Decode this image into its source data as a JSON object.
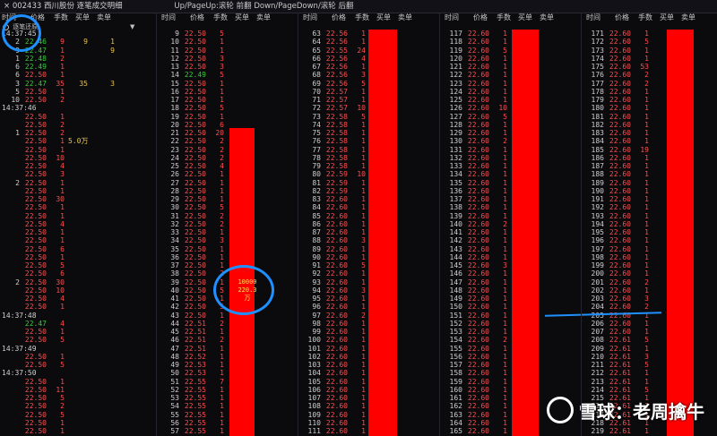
{
  "titlebar": {
    "title": "× 002433 西川股份 逐笔成交明细",
    "hint": "Up/PageUp:滚轮 前翻 Down/PageDown/滚轮 后翻"
  },
  "headers": [
    "时间",
    "价格",
    "手数",
    "买单",
    "卖单",
    "时间",
    "价格",
    "手数",
    "买单",
    "卖单",
    "时间",
    "价格",
    "手数",
    "买单",
    "卖单",
    "时间",
    "价格",
    "手数",
    "买单",
    "卖单",
    "时间",
    "价格",
    "手数",
    "买单",
    "卖单"
  ],
  "toggle_label": "逐笔还原",
  "big_order": {
    "volume": "10000",
    "amount": "220.3万"
  },
  "watermark": "雪球：老周擒牛",
  "colors": {
    "up": "#ff4d4d",
    "down": "#33cc33",
    "bar": "#ff0000",
    "circle": "#1e90ff"
  },
  "col1": [
    [
      "14:37:45",
      "",
      "",
      "",
      ""
    ],
    [
      "2",
      "22.46",
      "9",
      "9",
      "1"
    ],
    [
      "9",
      "22.47",
      "1",
      "",
      "9"
    ],
    [
      "1",
      "22.48",
      "2",
      "",
      ""
    ],
    [
      "6",
      "22.49",
      "1",
      "",
      ""
    ],
    [
      "6",
      "22.50",
      "1",
      "",
      ""
    ],
    [
      "3",
      "22.47",
      "35",
      "35",
      "3"
    ],
    [
      "5",
      "22.50",
      "1",
      "",
      ""
    ],
    [
      "10",
      "22.50",
      "2",
      "",
      ""
    ],
    [
      "14:37:46",
      "",
      "",
      "",
      ""
    ],
    [
      "",
      "22.50",
      "1",
      "",
      ""
    ],
    [
      "",
      "22.50",
      "2",
      "",
      ""
    ],
    [
      "1",
      "22.50",
      "2",
      "",
      ""
    ],
    [
      "",
      "22.50",
      "1",
      "5.0万",
      ""
    ],
    [
      "",
      "22.50",
      "1",
      "",
      ""
    ],
    [
      "",
      "22.50",
      "10",
      "",
      ""
    ],
    [
      "",
      "22.50",
      "4",
      "",
      ""
    ],
    [
      "",
      "22.50",
      "3",
      "",
      ""
    ],
    [
      "2",
      "22.50",
      "1",
      "",
      ""
    ],
    [
      "",
      "22.50",
      "1",
      "",
      ""
    ],
    [
      "",
      "22.50",
      "30",
      "",
      ""
    ],
    [
      "",
      "22.50",
      "1",
      "",
      ""
    ],
    [
      "",
      "22.50",
      "1",
      "",
      ""
    ],
    [
      "",
      "22.50",
      "4",
      "",
      ""
    ],
    [
      "",
      "22.50",
      "1",
      "",
      ""
    ],
    [
      "",
      "22.50",
      "1",
      "",
      ""
    ],
    [
      "",
      "22.50",
      "6",
      "",
      ""
    ],
    [
      "",
      "22.50",
      "1",
      "",
      ""
    ],
    [
      "",
      "22.50",
      "5",
      "",
      ""
    ],
    [
      "",
      "22.50",
      "6",
      "",
      ""
    ],
    [
      "2",
      "22.50",
      "30",
      "",
      ""
    ],
    [
      "",
      "22.50",
      "10",
      "",
      ""
    ],
    [
      "",
      "22.50",
      "4",
      "",
      ""
    ],
    [
      "",
      "22.50",
      "1",
      "",
      ""
    ],
    [
      "14:37:48",
      "",
      "",
      "",
      ""
    ],
    [
      "",
      "22.47",
      "4",
      "",
      ""
    ],
    [
      "",
      "22.50",
      "1",
      "",
      ""
    ],
    [
      "",
      "22.50",
      "5",
      "",
      ""
    ],
    [
      "14:37:49",
      "",
      "",
      "",
      ""
    ],
    [
      "",
      "22.50",
      "1",
      "",
      ""
    ],
    [
      "",
      "22.50",
      "5",
      "",
      ""
    ],
    [
      "14:37:50",
      "",
      "",
      "",
      ""
    ],
    [
      "",
      "22.50",
      "1",
      "",
      ""
    ],
    [
      "",
      "22.50",
      "11",
      "",
      ""
    ],
    [
      "",
      "22.50",
      "5",
      "",
      ""
    ],
    [
      "",
      "22.50",
      "2",
      "",
      ""
    ],
    [
      "",
      "22.50",
      "5",
      "",
      ""
    ],
    [
      "",
      "22.50",
      "1",
      "",
      ""
    ],
    [
      "",
      "22.50",
      "1",
      "",
      ""
    ]
  ],
  "col2": [
    [
      "9",
      "22.50",
      "5",
      "",
      ""
    ],
    [
      "10",
      "22.50",
      "1",
      "",
      ""
    ],
    [
      "11",
      "22.50",
      "1",
      "",
      ""
    ],
    [
      "12",
      "22.50",
      "3",
      "",
      ""
    ],
    [
      "13",
      "22.50",
      "3",
      "",
      ""
    ],
    [
      "14",
      "22.49",
      "5",
      "",
      ""
    ],
    [
      "15",
      "22.50",
      "1",
      "",
      ""
    ],
    [
      "16",
      "22.50",
      "1",
      "",
      ""
    ],
    [
      "17",
      "22.50",
      "1",
      "",
      ""
    ],
    [
      "18",
      "22.50",
      "5",
      "",
      ""
    ],
    [
      "19",
      "22.50",
      "1",
      "",
      ""
    ],
    [
      "20",
      "22.50",
      "6",
      "",
      ""
    ],
    [
      "21",
      "22.50",
      "20",
      "",
      ""
    ],
    [
      "22",
      "22.50",
      "2",
      "",
      ""
    ],
    [
      "23",
      "22.50",
      "2",
      "",
      ""
    ],
    [
      "24",
      "22.50",
      "2",
      "",
      ""
    ],
    [
      "25",
      "22.50",
      "4",
      "",
      ""
    ],
    [
      "26",
      "22.50",
      "1",
      "",
      ""
    ],
    [
      "27",
      "22.50",
      "1",
      "",
      ""
    ],
    [
      "28",
      "22.50",
      "1",
      "",
      ""
    ],
    [
      "29",
      "22.50",
      "1",
      "",
      ""
    ],
    [
      "30",
      "22.50",
      "5",
      "",
      ""
    ],
    [
      "31",
      "22.50",
      "2",
      "",
      ""
    ],
    [
      "32",
      "22.50",
      "2",
      "",
      ""
    ],
    [
      "33",
      "22.50",
      "1",
      "",
      ""
    ],
    [
      "34",
      "22.50",
      "3",
      "",
      ""
    ],
    [
      "35",
      "22.50",
      "1",
      "",
      ""
    ],
    [
      "36",
      "22.50",
      "1",
      "",
      ""
    ],
    [
      "37",
      "22.50",
      "1",
      "",
      ""
    ],
    [
      "38",
      "22.50",
      "2",
      "",
      ""
    ],
    [
      "39",
      "22.50",
      "1",
      "",
      ""
    ],
    [
      "40",
      "22.50",
      "5",
      "",
      ""
    ],
    [
      "41",
      "22.50",
      "1",
      "",
      ""
    ],
    [
      "42",
      "22.50",
      "5",
      "",
      ""
    ],
    [
      "43",
      "22.50",
      "1",
      "",
      ""
    ],
    [
      "44",
      "22.51",
      "2",
      "",
      ""
    ],
    [
      "45",
      "22.51",
      "1",
      "",
      ""
    ],
    [
      "46",
      "22.51",
      "2",
      "",
      ""
    ],
    [
      "47",
      "22.51",
      "1",
      "",
      ""
    ],
    [
      "48",
      "22.52",
      "1",
      "",
      ""
    ],
    [
      "49",
      "22.53",
      "1",
      "",
      ""
    ],
    [
      "50",
      "22.53",
      "1",
      "",
      ""
    ],
    [
      "51",
      "22.55",
      "7",
      "",
      ""
    ],
    [
      "52",
      "22.55",
      "1",
      "",
      ""
    ],
    [
      "53",
      "22.55",
      "1",
      "",
      ""
    ],
    [
      "54",
      "22.55",
      "1",
      "",
      ""
    ],
    [
      "55",
      "22.55",
      "1",
      "",
      ""
    ],
    [
      "56",
      "22.55",
      "1",
      "",
      ""
    ],
    [
      "57",
      "22.55",
      "1",
      "",
      ""
    ]
  ],
  "col3": [
    [
      "63",
      "22.56",
      "1",
      "",
      ""
    ],
    [
      "64",
      "22.56",
      "1",
      "",
      ""
    ],
    [
      "65",
      "22.55",
      "24",
      "",
      ""
    ],
    [
      "66",
      "22.56",
      "4",
      "",
      ""
    ],
    [
      "67",
      "22.56",
      "1",
      "",
      ""
    ],
    [
      "68",
      "22.56",
      "3",
      "",
      ""
    ],
    [
      "69",
      "22.56",
      "5",
      "",
      ""
    ],
    [
      "70",
      "22.57",
      "1",
      "",
      ""
    ],
    [
      "71",
      "22.57",
      "1",
      "",
      ""
    ],
    [
      "72",
      "22.57",
      "10",
      "",
      ""
    ],
    [
      "73",
      "22.58",
      "5",
      "",
      ""
    ],
    [
      "74",
      "22.58",
      "1",
      "",
      ""
    ],
    [
      "75",
      "22.58",
      "1",
      "",
      ""
    ],
    [
      "76",
      "22.58",
      "1",
      "",
      ""
    ],
    [
      "77",
      "22.58",
      "1",
      "",
      ""
    ],
    [
      "78",
      "22.58",
      "1",
      "",
      ""
    ],
    [
      "79",
      "22.58",
      "1",
      "",
      ""
    ],
    [
      "80",
      "22.59",
      "10",
      "",
      ""
    ],
    [
      "81",
      "22.59",
      "1",
      "",
      ""
    ],
    [
      "82",
      "22.59",
      "1",
      "",
      ""
    ],
    [
      "83",
      "22.60",
      "1",
      "",
      ""
    ],
    [
      "84",
      "22.60",
      "1",
      "",
      ""
    ],
    [
      "85",
      "22.60",
      "1",
      "",
      ""
    ],
    [
      "86",
      "22.60",
      "1",
      "",
      ""
    ],
    [
      "87",
      "22.60",
      "1",
      "",
      ""
    ],
    [
      "88",
      "22.60",
      "3",
      "",
      ""
    ],
    [
      "89",
      "22.60",
      "1",
      "",
      ""
    ],
    [
      "90",
      "22.60",
      "1",
      "",
      ""
    ],
    [
      "91",
      "22.60",
      "5",
      "",
      ""
    ],
    [
      "92",
      "22.60",
      "1",
      "",
      ""
    ],
    [
      "93",
      "22.60",
      "1",
      "",
      ""
    ],
    [
      "94",
      "22.60",
      "3",
      "",
      ""
    ],
    [
      "95",
      "22.60",
      "1",
      "",
      ""
    ],
    [
      "96",
      "22.60",
      "1",
      "",
      ""
    ],
    [
      "97",
      "22.60",
      "2",
      "",
      ""
    ],
    [
      "98",
      "22.60",
      "1",
      "",
      ""
    ],
    [
      "99",
      "22.60",
      "1",
      "",
      ""
    ],
    [
      "100",
      "22.60",
      "1",
      "",
      ""
    ],
    [
      "101",
      "22.60",
      "1",
      "",
      ""
    ],
    [
      "102",
      "22.60",
      "1",
      "",
      ""
    ],
    [
      "103",
      "22.60",
      "1",
      "",
      ""
    ],
    [
      "104",
      "22.60",
      "1",
      "",
      ""
    ],
    [
      "105",
      "22.60",
      "1",
      "",
      ""
    ],
    [
      "106",
      "22.60",
      "1",
      "",
      ""
    ],
    [
      "107",
      "22.60",
      "1",
      "",
      ""
    ],
    [
      "108",
      "22.60",
      "1",
      "",
      ""
    ],
    [
      "109",
      "22.60",
      "1",
      "",
      ""
    ],
    [
      "110",
      "22.60",
      "1",
      "",
      ""
    ],
    [
      "111",
      "22.60",
      "1",
      "",
      ""
    ]
  ],
  "col4": [
    [
      "117",
      "22.60",
      "1",
      "",
      ""
    ],
    [
      "118",
      "22.60",
      "1",
      "",
      ""
    ],
    [
      "119",
      "22.60",
      "5",
      "",
      ""
    ],
    [
      "120",
      "22.60",
      "1",
      "",
      ""
    ],
    [
      "121",
      "22.60",
      "1",
      "",
      ""
    ],
    [
      "122",
      "22.60",
      "1",
      "",
      ""
    ],
    [
      "123",
      "22.60",
      "1",
      "",
      ""
    ],
    [
      "124",
      "22.60",
      "1",
      "",
      ""
    ],
    [
      "125",
      "22.60",
      "1",
      "",
      ""
    ],
    [
      "126",
      "22.60",
      "10",
      "",
      ""
    ],
    [
      "127",
      "22.60",
      "5",
      "",
      ""
    ],
    [
      "128",
      "22.60",
      "1",
      "",
      ""
    ],
    [
      "129",
      "22.60",
      "1",
      "",
      ""
    ],
    [
      "130",
      "22.60",
      "2",
      "",
      ""
    ],
    [
      "131",
      "22.60",
      "1",
      "",
      ""
    ],
    [
      "132",
      "22.60",
      "1",
      "",
      ""
    ],
    [
      "133",
      "22.60",
      "1",
      "",
      ""
    ],
    [
      "134",
      "22.60",
      "1",
      "",
      ""
    ],
    [
      "135",
      "22.60",
      "1",
      "",
      ""
    ],
    [
      "136",
      "22.60",
      "1",
      "",
      ""
    ],
    [
      "137",
      "22.60",
      "1",
      "",
      ""
    ],
    [
      "138",
      "22.60",
      "1",
      "",
      ""
    ],
    [
      "139",
      "22.60",
      "1",
      "",
      ""
    ],
    [
      "140",
      "22.60",
      "2",
      "",
      ""
    ],
    [
      "141",
      "22.60",
      "1",
      "",
      ""
    ],
    [
      "142",
      "22.60",
      "1",
      "",
      ""
    ],
    [
      "143",
      "22.60",
      "1",
      "",
      ""
    ],
    [
      "144",
      "22.60",
      "1",
      "",
      ""
    ],
    [
      "145",
      "22.60",
      "3",
      "",
      ""
    ],
    [
      "146",
      "22.60",
      "1",
      "",
      ""
    ],
    [
      "147",
      "22.60",
      "1",
      "",
      ""
    ],
    [
      "148",
      "22.60",
      "1",
      "",
      ""
    ],
    [
      "149",
      "22.60",
      "1",
      "",
      ""
    ],
    [
      "150",
      "22.60",
      "1",
      "",
      ""
    ],
    [
      "151",
      "22.60",
      "1",
      "",
      ""
    ],
    [
      "152",
      "22.60",
      "1",
      "",
      ""
    ],
    [
      "153",
      "22.60",
      "1",
      "",
      ""
    ],
    [
      "154",
      "22.60",
      "2",
      "",
      ""
    ],
    [
      "155",
      "22.60",
      "1",
      "",
      ""
    ],
    [
      "156",
      "22.60",
      "1",
      "",
      ""
    ],
    [
      "157",
      "22.60",
      "1",
      "",
      ""
    ],
    [
      "158",
      "22.60",
      "1",
      "",
      ""
    ],
    [
      "159",
      "22.60",
      "1",
      "",
      ""
    ],
    [
      "160",
      "22.60",
      "1",
      "",
      ""
    ],
    [
      "161",
      "22.60",
      "1",
      "",
      ""
    ],
    [
      "162",
      "22.60",
      "1",
      "",
      ""
    ],
    [
      "163",
      "22.60",
      "1",
      "",
      ""
    ],
    [
      "164",
      "22.60",
      "1",
      "",
      ""
    ],
    [
      "165",
      "22.60",
      "1",
      "",
      ""
    ]
  ],
  "col5": [
    [
      "171",
      "22.60",
      "1",
      "",
      ""
    ],
    [
      "172",
      "22.60",
      "5",
      "",
      ""
    ],
    [
      "173",
      "22.60",
      "1",
      "",
      ""
    ],
    [
      "174",
      "22.60",
      "1",
      "",
      ""
    ],
    [
      "175",
      "22.60",
      "53",
      "",
      ""
    ],
    [
      "176",
      "22.60",
      "2",
      "",
      ""
    ],
    [
      "177",
      "22.60",
      "2",
      "",
      ""
    ],
    [
      "178",
      "22.60",
      "1",
      "",
      ""
    ],
    [
      "179",
      "22.60",
      "1",
      "",
      ""
    ],
    [
      "180",
      "22.60",
      "1",
      "",
      ""
    ],
    [
      "181",
      "22.60",
      "1",
      "",
      ""
    ],
    [
      "182",
      "22.60",
      "1",
      "",
      ""
    ],
    [
      "183",
      "22.60",
      "1",
      "",
      ""
    ],
    [
      "184",
      "22.60",
      "1",
      "",
      ""
    ],
    [
      "185",
      "22.60",
      "19",
      "",
      ""
    ],
    [
      "186",
      "22.60",
      "1",
      "",
      ""
    ],
    [
      "187",
      "22.60",
      "1",
      "",
      ""
    ],
    [
      "188",
      "22.60",
      "1",
      "",
      ""
    ],
    [
      "189",
      "22.60",
      "1",
      "",
      ""
    ],
    [
      "190",
      "22.60",
      "1",
      "",
      ""
    ],
    [
      "191",
      "22.60",
      "1",
      "",
      ""
    ],
    [
      "192",
      "22.60",
      "1",
      "",
      ""
    ],
    [
      "193",
      "22.60",
      "1",
      "",
      ""
    ],
    [
      "194",
      "22.60",
      "1",
      "",
      ""
    ],
    [
      "195",
      "22.60",
      "1",
      "",
      ""
    ],
    [
      "196",
      "22.60",
      "1",
      "",
      ""
    ],
    [
      "197",
      "22.60",
      "1",
      "",
      ""
    ],
    [
      "198",
      "22.60",
      "1",
      "",
      ""
    ],
    [
      "199",
      "22.60",
      "1",
      "",
      ""
    ],
    [
      "200",
      "22.60",
      "1",
      "",
      ""
    ],
    [
      "201",
      "22.60",
      "2",
      "",
      ""
    ],
    [
      "202",
      "22.60",
      "1",
      "",
      ""
    ],
    [
      "203",
      "22.60",
      "3",
      "",
      ""
    ],
    [
      "204",
      "22.60",
      "2",
      "",
      ""
    ],
    [
      "205",
      "22.60",
      "1",
      "",
      ""
    ],
    [
      "206",
      "22.60",
      "1",
      "",
      ""
    ],
    [
      "207",
      "22.60",
      "1",
      "",
      ""
    ],
    [
      "208",
      "22.61",
      "5",
      "",
      ""
    ],
    [
      "209",
      "22.61",
      "1",
      "",
      ""
    ],
    [
      "210",
      "22.61",
      "3",
      "",
      ""
    ],
    [
      "211",
      "22.61",
      "5",
      "",
      ""
    ],
    [
      "212",
      "22.61",
      "1",
      "",
      ""
    ],
    [
      "213",
      "22.61",
      "1",
      "",
      ""
    ],
    [
      "214",
      "22.61",
      "5",
      "",
      ""
    ],
    [
      "215",
      "22.61",
      "1",
      "",
      ""
    ],
    [
      "216",
      "22.61",
      "1",
      "",
      ""
    ],
    [
      "217",
      "22.61",
      "1",
      "",
      ""
    ],
    [
      "218",
      "22.61",
      "1",
      "",
      ""
    ],
    [
      "219",
      "22.61",
      "1",
      "",
      ""
    ]
  ]
}
